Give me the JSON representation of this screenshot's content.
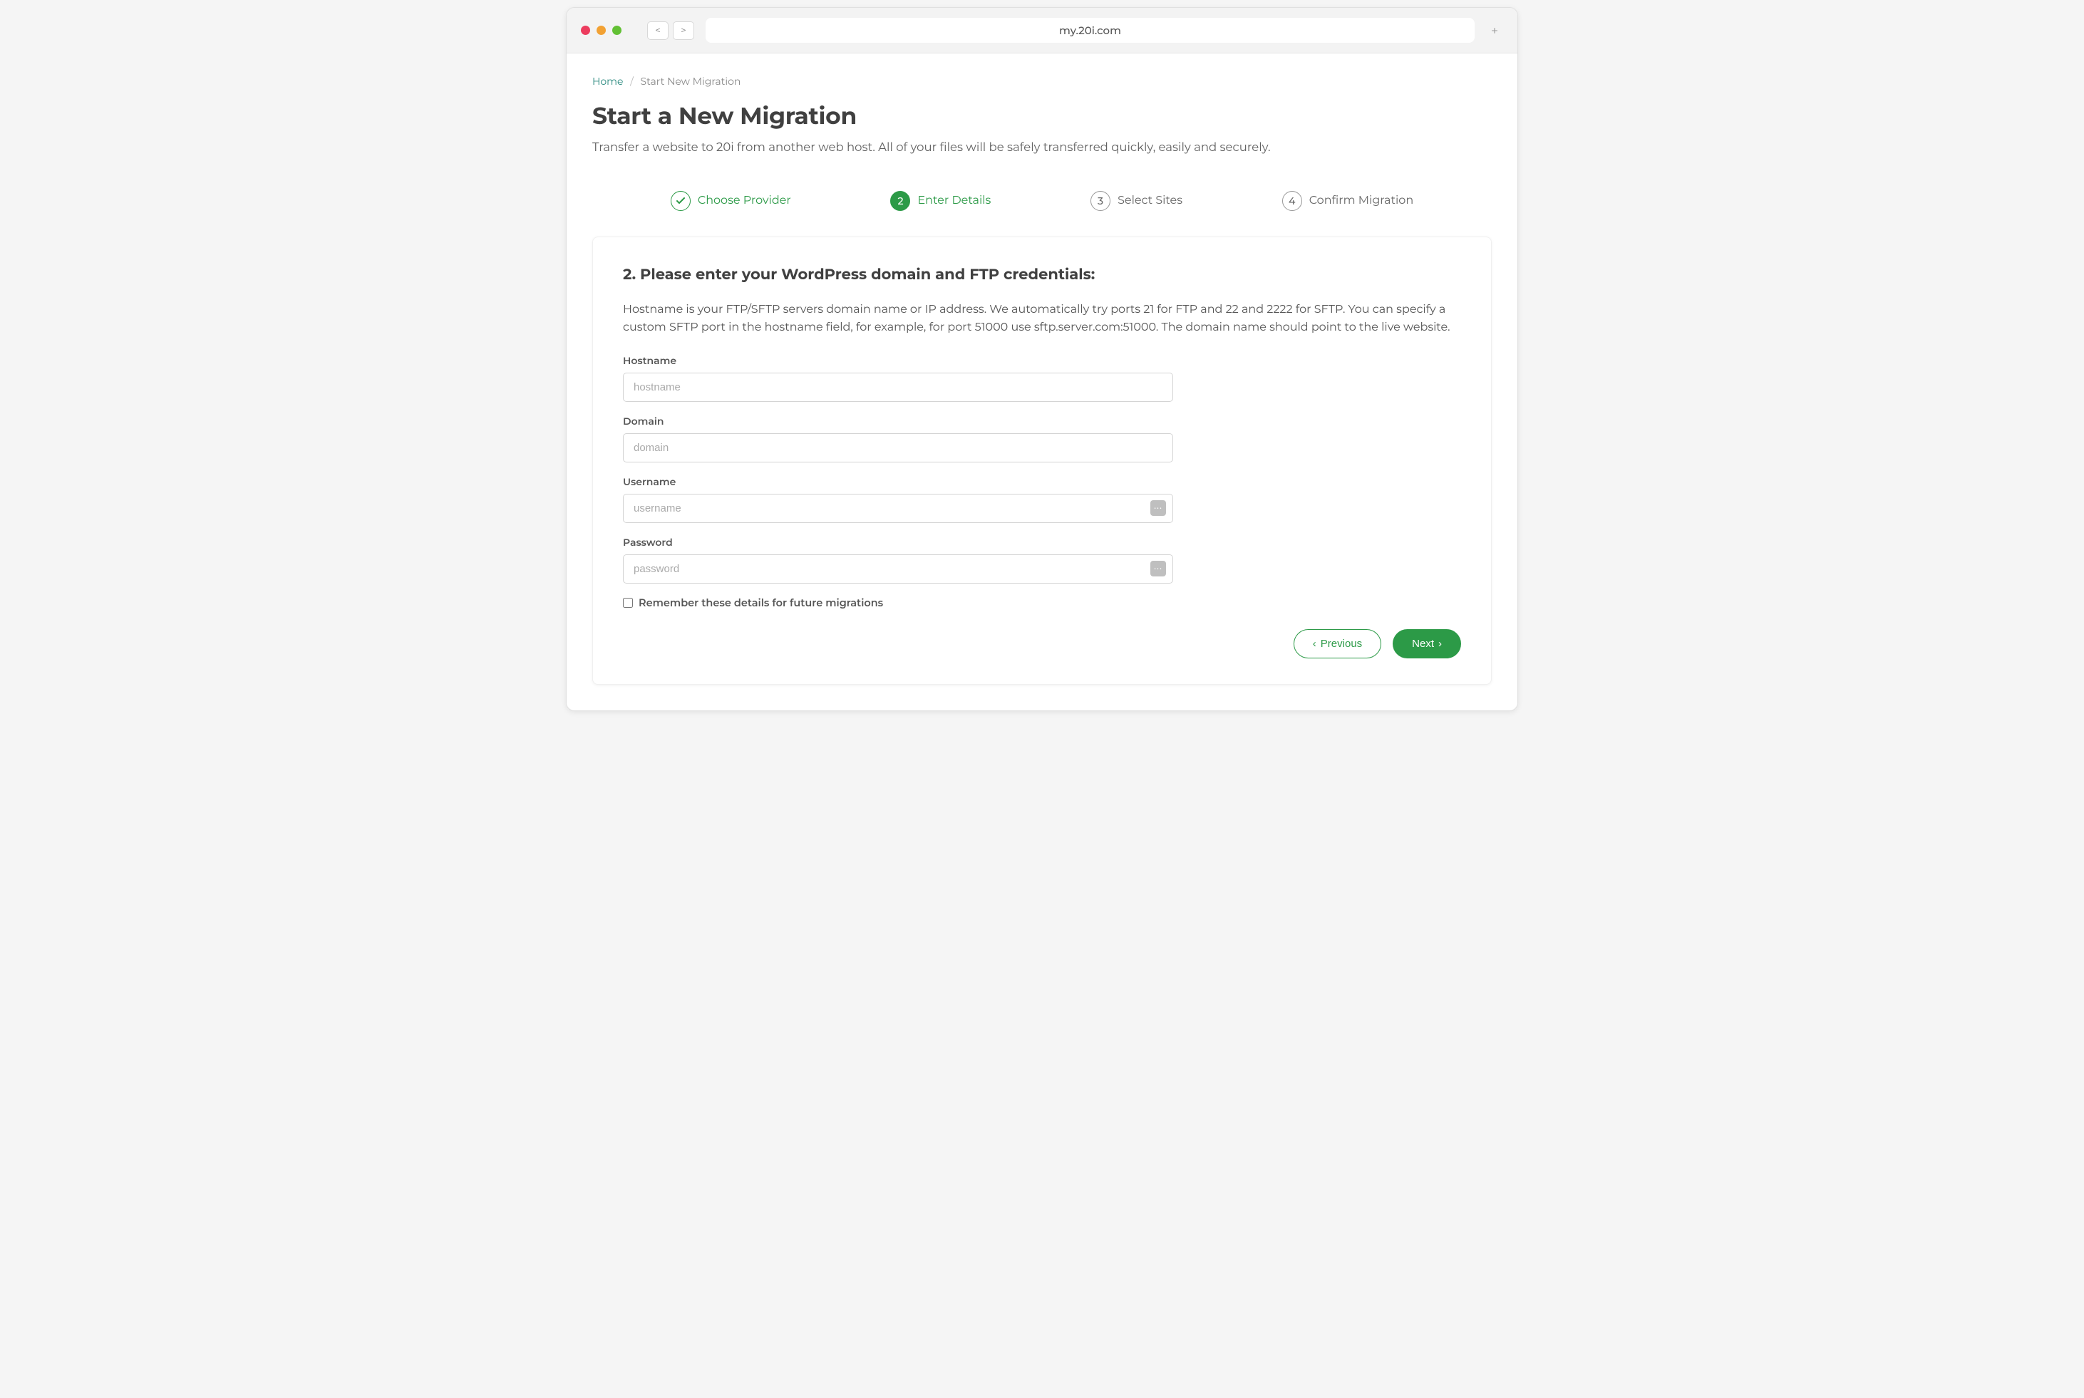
{
  "browser": {
    "url": "my.20i.com"
  },
  "breadcrumb": {
    "home": "Home",
    "current": "Start New Migration"
  },
  "page": {
    "title": "Start a New Migration",
    "subtitle": "Transfer a website to 20i from another web host. All of your files will be safely transferred quickly, easily and securely."
  },
  "steps": {
    "s1": {
      "num": "✓",
      "label": "Choose Provider"
    },
    "s2": {
      "num": "2",
      "label": "Enter Details"
    },
    "s3": {
      "num": "3",
      "label": "Select Sites"
    },
    "s4": {
      "num": "4",
      "label": "Confirm Migration"
    }
  },
  "card": {
    "title": "2. Please enter your WordPress domain and FTP credentials:",
    "description": "Hostname is your FTP/SFTP servers domain name or IP address. We automatically try ports 21 for FTP and 22 and 2222 for SFTP. You can specify a custom SFTP port in the hostname field, for example, for port 51000 use sftp.server.com:51000. The domain name should point to the live website."
  },
  "form": {
    "hostname": {
      "label": "Hostname",
      "placeholder": "hostname",
      "value": ""
    },
    "domain": {
      "label": "Domain",
      "placeholder": "domain",
      "value": ""
    },
    "username": {
      "label": "Username",
      "placeholder": "username",
      "value": ""
    },
    "password": {
      "label": "Password",
      "placeholder": "password",
      "value": ""
    },
    "remember": {
      "label": "Remember these details for future migrations",
      "checked": false
    }
  },
  "actions": {
    "previous": "Previous",
    "next": "Next"
  }
}
